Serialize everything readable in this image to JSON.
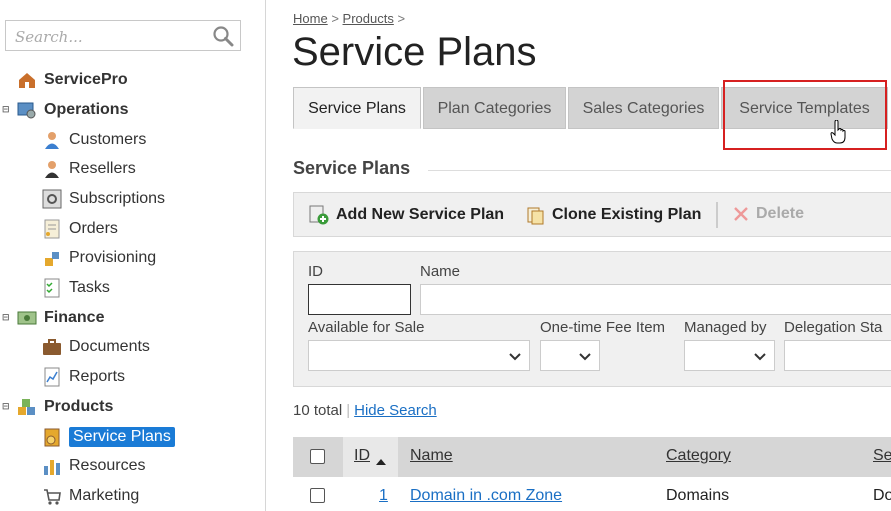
{
  "sidebar": {
    "search_placeholder": "Search...",
    "items": [
      {
        "label": "ServicePro",
        "icon": "servicepro-icon"
      },
      {
        "label": "Operations",
        "icon": "operations-icon"
      },
      {
        "label": "Customers",
        "icon": "customer-icon"
      },
      {
        "label": "Resellers",
        "icon": "reseller-icon"
      },
      {
        "label": "Subscriptions",
        "icon": "subscriptions-icon"
      },
      {
        "label": "Orders",
        "icon": "orders-icon"
      },
      {
        "label": "Provisioning",
        "icon": "provisioning-icon"
      },
      {
        "label": "Tasks",
        "icon": "tasks-icon"
      },
      {
        "label": "Finance",
        "icon": "finance-icon"
      },
      {
        "label": "Documents",
        "icon": "documents-icon"
      },
      {
        "label": "Reports",
        "icon": "reports-icon"
      },
      {
        "label": "Products",
        "icon": "products-icon"
      },
      {
        "label": "Service Plans",
        "icon": "service-plans-icon"
      },
      {
        "label": "Resources",
        "icon": "resources-icon"
      },
      {
        "label": "Marketing",
        "icon": "marketing-icon"
      }
    ]
  },
  "breadcrumb": {
    "home": "Home",
    "sep1": ">",
    "products": "Products",
    "sep2": ">"
  },
  "page_title": "Service Plans",
  "tabs": [
    "Service Plans",
    "Plan Categories",
    "Sales Categories",
    "Service Templates"
  ],
  "active_tab": "Service Plans",
  "section_title": "Service Plans",
  "toolbar": {
    "add": "Add New Service Plan",
    "clone": "Clone Existing Plan",
    "delete": "Delete"
  },
  "filter": {
    "id_label": "ID",
    "name_label": "Name",
    "available_label": "Available for Sale",
    "onetime_label": "One-time Fee Item",
    "managed_label": "Managed by",
    "delegation_label": "Delegation Sta"
  },
  "summary": {
    "total": "10 total",
    "separator": "|",
    "hide_search": "Hide Search"
  },
  "table": {
    "headers": {
      "id": "ID",
      "name": "Name",
      "category": "Category",
      "service": "Se"
    },
    "rows": [
      {
        "id": "1",
        "name": "Domain in .com Zone",
        "category": "Domains",
        "service": "Do"
      }
    ]
  },
  "colors": {
    "selected": "#1a7bd6",
    "highlight_box": "#d62020",
    "link": "#1a6fc4"
  }
}
